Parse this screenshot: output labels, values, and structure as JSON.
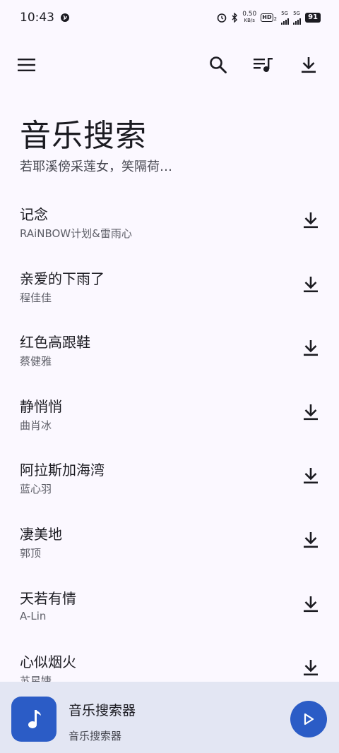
{
  "status_bar": {
    "time": "10:43",
    "net_speed_value": "0.50",
    "net_speed_unit": "KB/s",
    "hd_label": "HD",
    "hd_sub": "2",
    "sim1_label": "5G",
    "sim2_label": "5G",
    "battery": "91"
  },
  "toolbar": {
    "menu_icon": "menu-icon",
    "search_icon": "search-icon",
    "queue_icon": "queue-music-icon",
    "download_icon": "download-icon"
  },
  "header": {
    "title": "音乐搜索",
    "subtitle": "若耶溪傍采莲女，笑隔荷…"
  },
  "songs": [
    {
      "title": "记念",
      "artist": "RAiNBOW计划&雷雨心"
    },
    {
      "title": "亲爱的下雨了",
      "artist": "程佳佳"
    },
    {
      "title": "红色高跟鞋",
      "artist": "蔡健雅"
    },
    {
      "title": "静悄悄",
      "artist": "曲肖冰"
    },
    {
      "title": "阿拉斯加海湾",
      "artist": "蓝心羽"
    },
    {
      "title": "凄美地",
      "artist": "郭顶"
    },
    {
      "title": "天若有情",
      "artist": "A-Lin"
    },
    {
      "title": "心似烟火",
      "artist": "苏星婕"
    }
  ],
  "player": {
    "title": "音乐搜索器",
    "subtitle": "音乐搜索器"
  },
  "colors": {
    "background": "#fbf8ff",
    "accent": "#2b5cc6",
    "player_bar": "#e3e6f3"
  }
}
